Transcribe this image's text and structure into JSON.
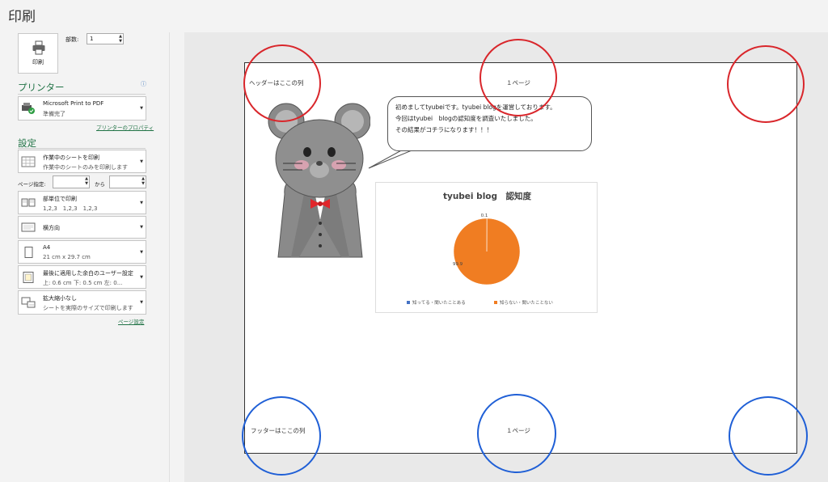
{
  "page": {
    "title": "印刷"
  },
  "print": {
    "button_label": "印刷",
    "copies_label": "部数:",
    "copies_value": "1"
  },
  "printer": {
    "section_title": "プリンター",
    "name": "Microsoft Print to PDF",
    "status": "準備完了",
    "properties_link": "プリンターのプロパティ"
  },
  "settings": {
    "section_title": "設定",
    "print_what": {
      "main": "作業中のシートを印刷",
      "sub": "作業中のシートのみを印刷します"
    },
    "pages_label": "ページ指定:",
    "pages_to": "から",
    "collate": {
      "main": "部単位で印刷",
      "sub": "1,2,3　1,2,3　1,2,3"
    },
    "orientation": {
      "main": "横方向"
    },
    "paper": {
      "main": "A4",
      "sub": "21 cm x 29.7 cm"
    },
    "margins": {
      "main": "最後に適用した余白のユーザー設定",
      "sub": "上: 0.6 cm 下: 0.5 cm 左: 0..."
    },
    "scaling": {
      "main": "拡大縮小なし",
      "sub": "シートを実際のサイズで印刷します"
    },
    "page_setup_link": "ページ設定"
  },
  "preview": {
    "header_left": "ヘッダーはここの列",
    "header_center": "１ページ",
    "footer_left": "フッターはここの列",
    "footer_center": "１ページ",
    "bubble_lines": [
      "初めましてtyubeiです。tyubei blogを運営しております。",
      "今回はtyubei　blogの認知度を調査いたしました。",
      "その結果がコチラになります！！！"
    ]
  },
  "colors": {
    "accent": "#217346",
    "highlight_red": "#d9262b",
    "highlight_blue": "#1f5fd6",
    "pie_orange": "#f07d22",
    "pie_blue": "#4472c4"
  },
  "chart_data": {
    "type": "pie",
    "title": "tyubei blog　認知度",
    "categories": [
      "知ってる・聞いたことある",
      "知らない・聞いたことない"
    ],
    "values": [
      0.1,
      99.9
    ],
    "data_labels": [
      "0.1",
      "99.9"
    ],
    "legend": "bottom"
  }
}
